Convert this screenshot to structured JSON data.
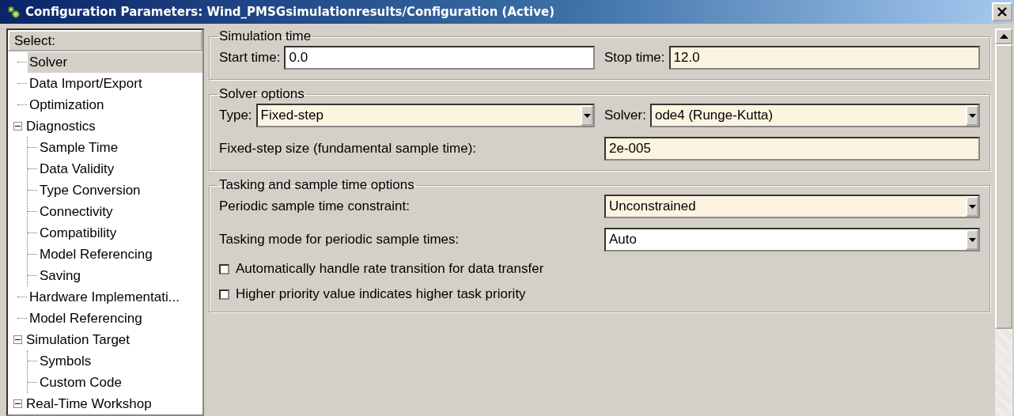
{
  "window": {
    "title": "Configuration Parameters: Wind_PMSGsimulationresults/Configuration (Active)"
  },
  "sidebar": {
    "header": "Select:",
    "items": [
      {
        "label": "Solver",
        "selected": true
      },
      {
        "label": "Data Import/Export",
        "selected": false
      },
      {
        "label": "Optimization",
        "selected": false
      },
      {
        "label": "Diagnostics",
        "selected": false,
        "expanded": true,
        "children": [
          {
            "label": "Sample Time",
            "selected": false
          },
          {
            "label": "Data Validity",
            "selected": false
          },
          {
            "label": "Type Conversion",
            "selected": false
          },
          {
            "label": "Connectivity",
            "selected": false
          },
          {
            "label": "Compatibility",
            "selected": false
          },
          {
            "label": "Model Referencing",
            "selected": false
          },
          {
            "label": "Saving",
            "selected": false
          }
        ]
      },
      {
        "label": "Hardware Implementati...",
        "selected": false
      },
      {
        "label": "Model Referencing",
        "selected": false
      },
      {
        "label": "Simulation Target",
        "selected": false,
        "expanded": true,
        "children": [
          {
            "label": "Symbols",
            "selected": false
          },
          {
            "label": "Custom Code",
            "selected": false
          }
        ]
      },
      {
        "label": "Real-Time Workshop",
        "selected": false,
        "expanded": true
      }
    ]
  },
  "sections": [
    {
      "title": "Simulation time",
      "rows": [
        [
          {
            "kind": "text",
            "label": "Start time:",
            "value": "0.0",
            "highlighted": false
          },
          {
            "kind": "text",
            "label": "Stop time:",
            "value": "12.0",
            "highlighted": true
          }
        ]
      ]
    },
    {
      "title": "Solver options",
      "rows": [
        [
          {
            "kind": "dropdown",
            "label": "Type:",
            "value": "Fixed-step",
            "highlighted": true
          },
          {
            "kind": "dropdown",
            "label": "Solver:",
            "value": "ode4 (Runge-Kutta)",
            "highlighted": true
          }
        ],
        [
          {
            "kind": "text",
            "label": "Fixed-step size (fundamental sample time):",
            "value": "2e-005",
            "highlighted": true
          }
        ]
      ]
    },
    {
      "title": "Tasking and sample time options",
      "rows": [
        [
          {
            "kind": "dropdown",
            "label": "Periodic sample time constraint:",
            "value": "Unconstrained",
            "highlighted": true
          }
        ],
        [
          {
            "kind": "dropdown",
            "label": "Tasking mode for periodic sample times:",
            "value": "Auto",
            "highlighted": false
          }
        ],
        [
          {
            "kind": "checkbox",
            "label": "Automatically handle rate transition for data transfer",
            "checked": false
          }
        ],
        [
          {
            "kind": "checkbox",
            "label": "Higher priority value indicates higher task priority",
            "checked": false
          }
        ]
      ]
    }
  ]
}
